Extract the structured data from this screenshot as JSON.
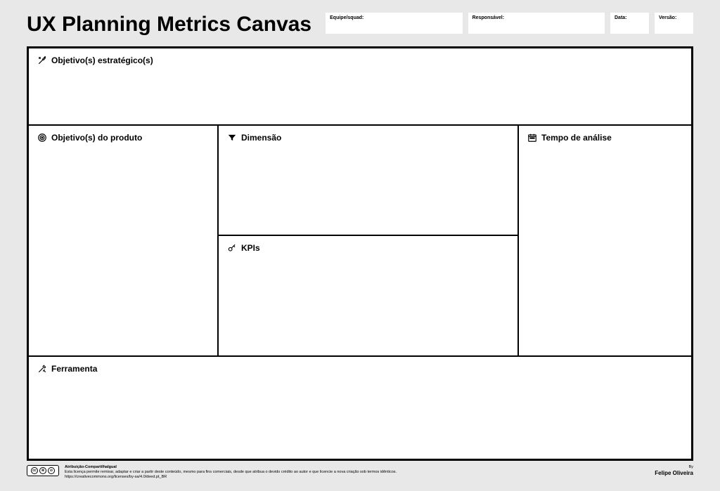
{
  "title": "UX Planning Metrics Canvas",
  "meta": {
    "team_label": "Equipe/squad:",
    "responsible_label": "Responsável:",
    "date_label": "Data:",
    "version_label": "Versão:"
  },
  "sections": {
    "strategic": "Objetivo(s) estratégico(s)",
    "product": "Objetivo(s) do produto",
    "dimension": "Dimensão",
    "kpis": "KPIs",
    "time": "Tempo de análise",
    "tool": "Ferramenta"
  },
  "footer": {
    "license_title": "Atribuição-CompartilhaIgual",
    "license_text": "Esta licença permite remixar, adaptar e criar a partir deste conteúdo, mesmo para fins comerciais, desde que atribua o devido crédito ao autor e que licencie a nova criação sob termos idênticos.",
    "license_url": "https://creativecommons.org/licenses/by-sa/4.0/deed.pt_BR",
    "by_label": "By",
    "author": "Felipe Oliveira"
  }
}
